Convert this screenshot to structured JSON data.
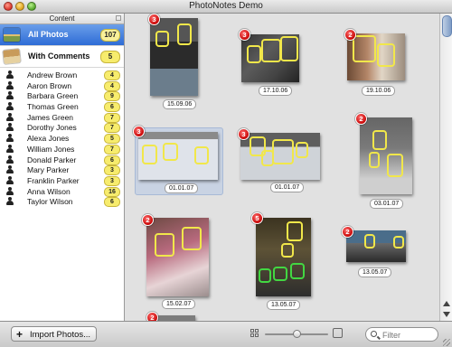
{
  "window": {
    "title": "PhotoNotes Demo"
  },
  "sidebar": {
    "header": "Content",
    "nav": [
      {
        "label": "All Photos",
        "count": "107",
        "selected": true
      },
      {
        "label": "With Comments",
        "count": "5",
        "selected": false
      }
    ],
    "people": [
      {
        "name": "Andrew Brown",
        "count": "4"
      },
      {
        "name": "Aaron Brown",
        "count": "4"
      },
      {
        "name": "Barbara Green",
        "count": "9"
      },
      {
        "name": "Thomas Green",
        "count": "6"
      },
      {
        "name": "James Green",
        "count": "7"
      },
      {
        "name": "Dorothy Jones",
        "count": "7"
      },
      {
        "name": "Alexa Jones",
        "count": "5"
      },
      {
        "name": "William Jones",
        "count": "7"
      },
      {
        "name": "Donald Parker",
        "count": "6"
      },
      {
        "name": "Mary Parker",
        "count": "3"
      },
      {
        "name": "Franklin Parker",
        "count": "3"
      },
      {
        "name": "Anna Wilson",
        "count": "16"
      },
      {
        "name": "Taylor Wilson",
        "count": "6"
      }
    ]
  },
  "photos": [
    {
      "badge": "3",
      "date": "15.09.06"
    },
    {
      "badge": "3",
      "date": "17.10.06"
    },
    {
      "badge": "2",
      "date": "19.10.06"
    },
    {
      "badge": "3",
      "date": "01.01.07"
    },
    {
      "badge": "3",
      "date": "01.01.07"
    },
    {
      "badge": "2",
      "date": "03.01.07"
    },
    {
      "badge": "2",
      "date": "15.02.07"
    },
    {
      "badge": "5",
      "date": "13.05.07"
    },
    {
      "badge": "2",
      "date": "13.05.07"
    },
    {
      "badge": "2",
      "date": ""
    }
  ],
  "bottom_bar": {
    "import_label": "Import Photos...",
    "search_placeholder": "Filter"
  }
}
